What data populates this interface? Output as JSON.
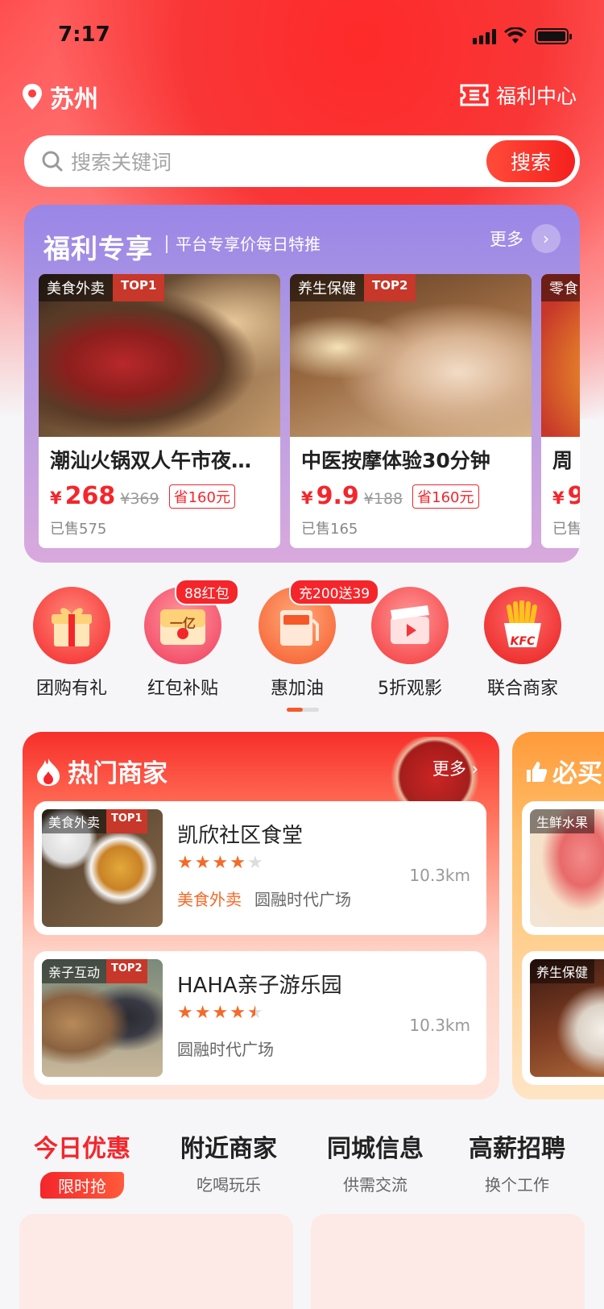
{
  "status_bar": {
    "time": "7:17"
  },
  "header": {
    "city": "苏州",
    "welfare_center": "福利中心"
  },
  "search": {
    "placeholder": "搜索关键词",
    "button": "搜索"
  },
  "welfare_panel": {
    "title": "福利专享",
    "subtitle": "平台专享价每日特推",
    "more": "更多",
    "deals": [
      {
        "category": "美食外卖",
        "rank": "TOP1",
        "name": "潮汕火锅双人午市夜…",
        "currency": "¥",
        "price": "268",
        "original": "¥369",
        "save": "省160元",
        "sold": "已售575"
      },
      {
        "category": "养生保健",
        "rank": "TOP2",
        "name": "中医按摩体验30分钟",
        "currency": "¥",
        "price": "9.9",
        "original": "¥188",
        "save": "省160元",
        "sold": "已售165"
      },
      {
        "category": "零食",
        "rank": "",
        "name": "周",
        "currency": "¥",
        "price": "9",
        "original": "",
        "save": "",
        "sold": "已售"
      }
    ]
  },
  "categories": [
    {
      "label": "团购有礼",
      "badge": ""
    },
    {
      "label": "红包补贴",
      "badge": "88红包",
      "icon_text": "一亿"
    },
    {
      "label": "惠加油",
      "badge": "充200送39"
    },
    {
      "label": "5折观影",
      "badge": ""
    },
    {
      "label": "联合商家",
      "badge": "",
      "icon_text": "KFC"
    }
  ],
  "hot_merchants": {
    "title": "热门商家",
    "more": "更多",
    "items": [
      {
        "category": "美食外卖",
        "rank": "TOP1",
        "name": "凯欣社区食堂",
        "rating": 4,
        "distance": "10.3km",
        "tag": "美食外卖",
        "location": "圆融时代广场"
      },
      {
        "category": "亲子互动",
        "rank": "TOP2",
        "name": "HAHA亲子游乐园",
        "rating": 4.5,
        "distance": "10.3km",
        "tag": "",
        "location": "圆融时代广场"
      }
    ]
  },
  "must_buy": {
    "title": "必买",
    "items": [
      {
        "category": "生鲜水果"
      },
      {
        "category": "养生保健"
      }
    ]
  },
  "tabs": [
    {
      "main": "今日优惠",
      "sub": "限时抢",
      "active": true
    },
    {
      "main": "附近商家",
      "sub": "吃喝玩乐",
      "active": false
    },
    {
      "main": "同城信息",
      "sub": "供需交流",
      "active": false
    },
    {
      "main": "高薪招聘",
      "sub": "换个工作",
      "active": false
    }
  ],
  "colors": {
    "accent": "#f4262b",
    "orange": "#f46a28",
    "panel": "#9a86e6"
  }
}
